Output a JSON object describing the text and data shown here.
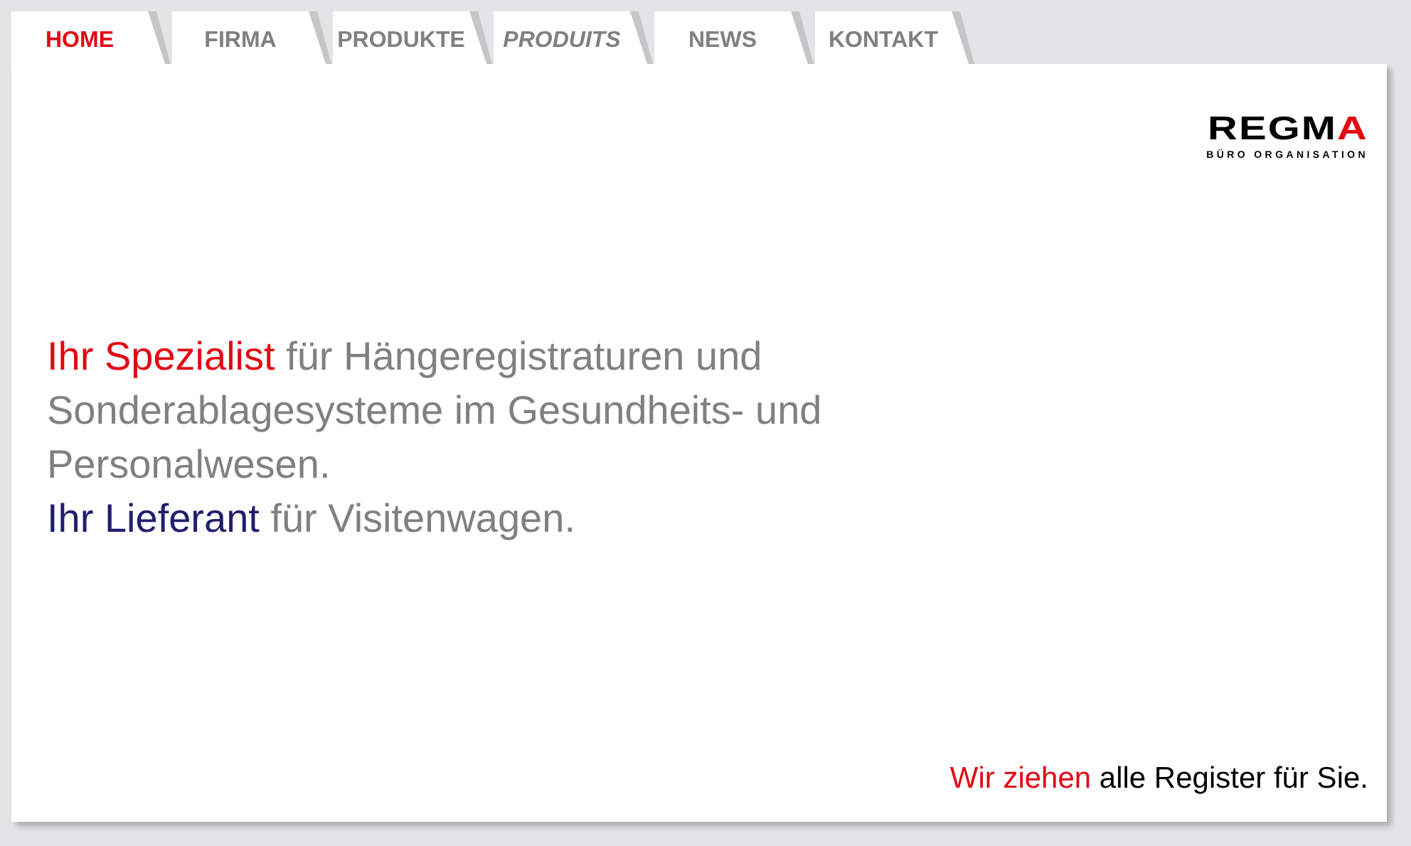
{
  "tabs": [
    {
      "label": "HOME",
      "selected": true,
      "italic": false
    },
    {
      "label": "FIRMA",
      "selected": false,
      "italic": false
    },
    {
      "label": "PRODUKTE",
      "selected": false,
      "italic": false
    },
    {
      "label": "PRODUITS",
      "selected": false,
      "italic": true
    },
    {
      "label": "NEWS",
      "selected": false,
      "italic": false
    },
    {
      "label": "KONTAKT",
      "selected": false,
      "italic": false
    }
  ],
  "logo": {
    "name": "REGM",
    "name_accent": "A",
    "tagline": "BÜRO ORGANISATION"
  },
  "headline": [
    {
      "accent": "Ihr Spezialist",
      "kind": "primary",
      "rest": " für Hängeregistraturen und Sonderablagesysteme im Gesundheits- und Personalwesen."
    },
    {
      "accent": "Ihr Lieferant",
      "kind": "secondary",
      "rest": " für Visitenwagen."
    }
  ],
  "slogan": {
    "accent": "Wir ziehen",
    "rest": " alle Register für Sie."
  }
}
